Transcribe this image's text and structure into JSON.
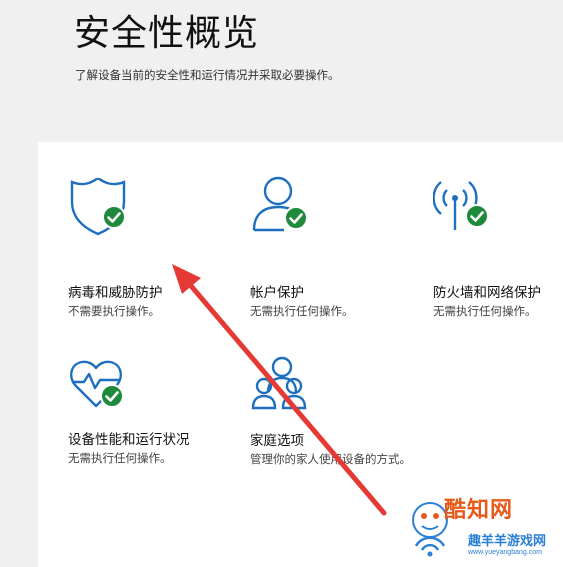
{
  "page": {
    "title": "安全性概览",
    "subtitle": "了解设备当前的安全性和运行情况并采取必要操作。"
  },
  "tiles": [
    {
      "title": "病毒和威胁防护",
      "status": "不需要执行操作。",
      "icon": "shield-check-icon"
    },
    {
      "title": "帐户保护",
      "status": "无需执行任何操作。",
      "icon": "account-check-icon"
    },
    {
      "title": "防火墙和网络保护",
      "status": "无需执行任何操作。",
      "icon": "wifi-antenna-check-icon"
    },
    {
      "title": "设备性能和运行状况",
      "status": "无需执行任何操作。",
      "icon": "heart-pulse-check-icon"
    },
    {
      "title": "家庭选项",
      "status": "管理你的家人使用设备的方式。",
      "icon": "family-icon"
    }
  ],
  "watermark": {
    "brand": "酷知网",
    "site_name": "趣羊羊游戏网",
    "site_url": "www.yueyangbang.com"
  },
  "colors": {
    "accent": "#1e6fbf",
    "ok_badge": "#1f8a3b",
    "arrow": "#e53935",
    "panel": "#ffffff",
    "background": "#f0f0f0"
  }
}
